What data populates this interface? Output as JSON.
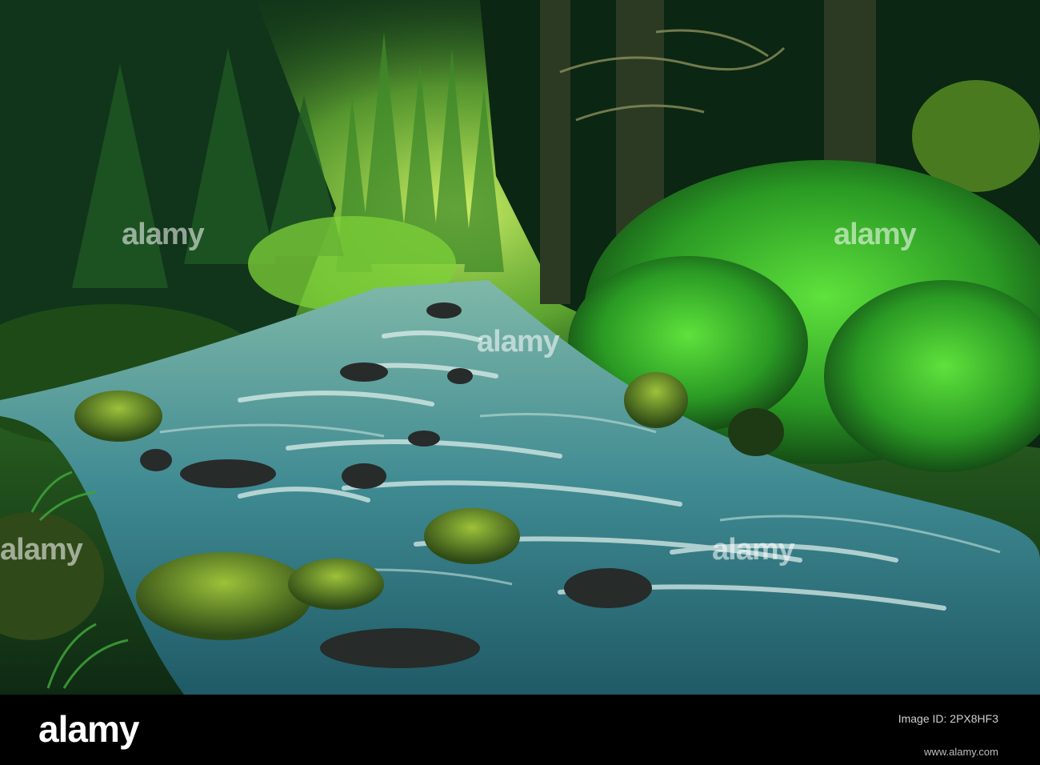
{
  "image": {
    "description_colors": {
      "forest_dark": "#0d2a14",
      "forest_mid": "#1f5a22",
      "foliage_bright": "#3dbd2c",
      "light_glow": "#c7f05a",
      "water": "#4f9aa0",
      "water_foam": "#d6ece8",
      "rock": "#2a2e2c",
      "moss": "#6f9a2a"
    }
  },
  "watermark": {
    "text": "alamy"
  },
  "footer": {
    "logo": "alamy",
    "image_id_label": "Image ID: 2PX8HF3",
    "image_id": "2PX8HF3",
    "url": "www.alamy.com"
  }
}
